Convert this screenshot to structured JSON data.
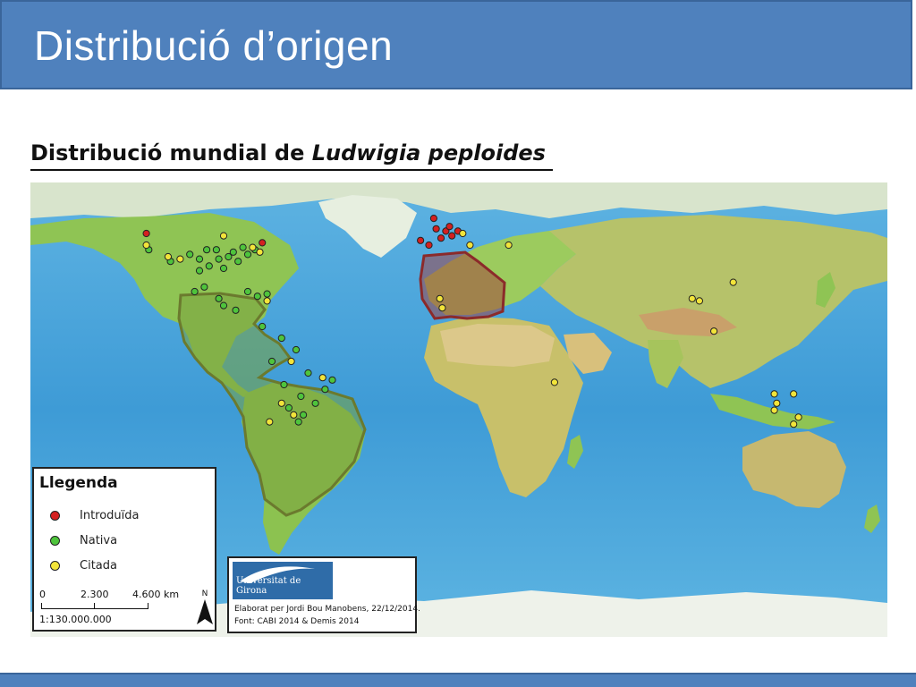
{
  "slide": {
    "title": "Distribució d’origen",
    "subtitle_prefix": "Distribució mundial de ",
    "subtitle_species": "Ludwigia peploides"
  },
  "colors": {
    "header": "#4f81bd",
    "introduced": "#d42020",
    "native": "#4ec43c",
    "cited": "#f2e43a",
    "native_area": "#7aa23e",
    "introduced_area": "#a33a3a",
    "ocean": "#4da6dd"
  },
  "legend": {
    "title": "Llegenda",
    "items": [
      {
        "label": "Introduïda",
        "color": "#d42020"
      },
      {
        "label": "Nativa",
        "color": "#4ec43c"
      },
      {
        "label": "Citada",
        "color": "#f2e43a"
      }
    ],
    "scale": {
      "labels": [
        "0",
        "2.300",
        "4.600 km"
      ],
      "ratio": "1:130.000.000"
    },
    "north": "N"
  },
  "credits": {
    "logo_text": "Universitat de Girona",
    "line1": "Elaborat per Jordi Bou Manobens, 22/12/2014.",
    "line2": "Font: CABI 2014 & Demis 2014"
  },
  "map_points": {
    "introduced": [
      {
        "lon": -122,
        "lat": 45
      },
      {
        "lon": -74,
        "lat": 41
      },
      {
        "lon": -8.5,
        "lat": 42
      },
      {
        "lon": -5,
        "lat": 40
      },
      {
        "lon": -2,
        "lat": 47
      },
      {
        "lon": 0,
        "lat": 43
      },
      {
        "lon": 2,
        "lat": 46
      },
      {
        "lon": 3.5,
        "lat": 48
      },
      {
        "lon": 4.5,
        "lat": 44
      },
      {
        "lon": 7,
        "lat": 46
      },
      {
        "lon": -3,
        "lat": 51.5
      }
    ],
    "native": [
      {
        "lon": -121,
        "lat": 38
      },
      {
        "lon": -112,
        "lat": 33
      },
      {
        "lon": -104,
        "lat": 36
      },
      {
        "lon": -100,
        "lat": 34
      },
      {
        "lon": -96,
        "lat": 31
      },
      {
        "lon": -92,
        "lat": 34
      },
      {
        "lon": -88,
        "lat": 35
      },
      {
        "lon": -84,
        "lat": 33
      },
      {
        "lon": -80,
        "lat": 36
      },
      {
        "lon": -77,
        "lat": 38
      },
      {
        "lon": -97,
        "lat": 38
      },
      {
        "lon": -93,
        "lat": 38
      },
      {
        "lon": -90,
        "lat": 30
      },
      {
        "lon": -86,
        "lat": 37
      },
      {
        "lon": -82,
        "lat": 39
      },
      {
        "lon": -100,
        "lat": 29
      },
      {
        "lon": -98,
        "lat": 22
      },
      {
        "lon": -102,
        "lat": 20
      },
      {
        "lon": -92,
        "lat": 17
      },
      {
        "lon": -90,
        "lat": 14
      },
      {
        "lon": -85,
        "lat": 12
      },
      {
        "lon": -80,
        "lat": 20
      },
      {
        "lon": -76,
        "lat": 18
      },
      {
        "lon": -72,
        "lat": 19
      },
      {
        "lon": -74,
        "lat": 5
      },
      {
        "lon": -66,
        "lat": 0
      },
      {
        "lon": -60,
        "lat": -5
      },
      {
        "lon": -70,
        "lat": -10
      },
      {
        "lon": -55,
        "lat": -15
      },
      {
        "lon": -65,
        "lat": -20
      },
      {
        "lon": -58,
        "lat": -25
      },
      {
        "lon": -52,
        "lat": -28
      },
      {
        "lon": -63,
        "lat": -30
      },
      {
        "lon": -57,
        "lat": -33
      },
      {
        "lon": -48,
        "lat": -22
      },
      {
        "lon": -45,
        "lat": -18
      },
      {
        "lon": -59,
        "lat": -36
      }
    ],
    "cited": [
      {
        "lon": -122,
        "lat": 40
      },
      {
        "lon": -113,
        "lat": 35
      },
      {
        "lon": -108,
        "lat": 34
      },
      {
        "lon": -90,
        "lat": 44
      },
      {
        "lon": -78,
        "lat": 39
      },
      {
        "lon": -75,
        "lat": 37
      },
      {
        "lon": -72,
        "lat": 16
      },
      {
        "lon": -62,
        "lat": -10
      },
      {
        "lon": -49,
        "lat": -17
      },
      {
        "lon": -61,
        "lat": -33
      },
      {
        "lon": -71,
        "lat": -36
      },
      {
        "lon": -66,
        "lat": -28
      },
      {
        "lon": 9,
        "lat": 45
      },
      {
        "lon": 12,
        "lat": 40
      },
      {
        "lon": 28,
        "lat": 40
      },
      {
        "lon": -0.5,
        "lat": 17
      },
      {
        "lon": 0.5,
        "lat": 13
      },
      {
        "lon": 47,
        "lat": -19
      },
      {
        "lon": 104,
        "lat": 17
      },
      {
        "lon": 107,
        "lat": 16
      },
      {
        "lon": 121,
        "lat": 24
      },
      {
        "lon": 113,
        "lat": 3
      },
      {
        "lon": 138,
        "lat": -24
      },
      {
        "lon": 139,
        "lat": -28
      },
      {
        "lon": 138,
        "lat": -31
      },
      {
        "lon": 146,
        "lat": -24
      },
      {
        "lon": 148,
        "lat": -34
      },
      {
        "lon": 146,
        "lat": -37
      }
    ]
  }
}
